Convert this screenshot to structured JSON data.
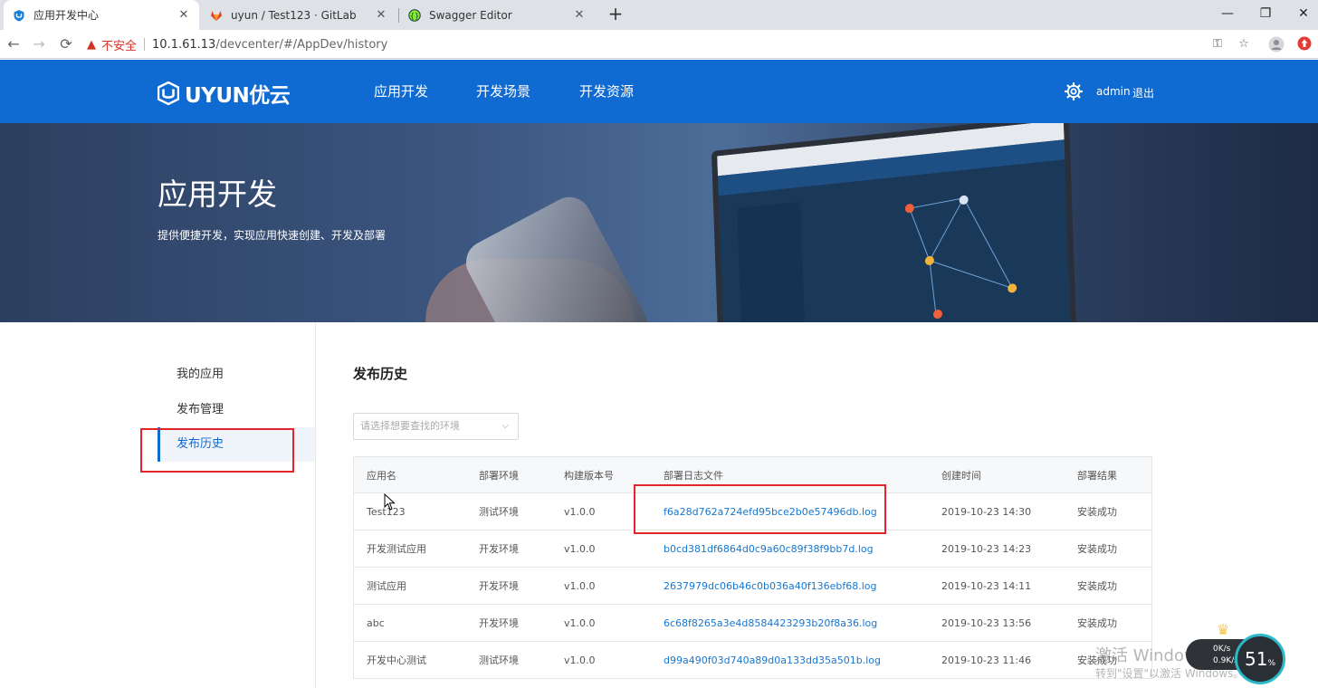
{
  "browser": {
    "tabs": [
      {
        "title": "应用开发中心",
        "active": true,
        "favicon": "uyun-shield-icon"
      },
      {
        "title": "uyun / Test123 · GitLab",
        "active": false,
        "favicon": "gitlab-fox-icon"
      },
      {
        "title": "Swagger Editor",
        "active": false,
        "favicon": "swagger-icon"
      }
    ],
    "new_tab": "+",
    "security_warning": "不安全",
    "url_host": "10.1.61.13",
    "url_path": "/devcenter/#/AppDev/history"
  },
  "header": {
    "logo_text": "UYUN优云",
    "nav": [
      "应用开发",
      "开发场景",
      "开发资源"
    ],
    "user": "admin",
    "logout": "退出",
    "brand_color": "#0f6ad1"
  },
  "banner": {
    "title": "应用开发",
    "subtitle": "提供便捷开发，实现应用快速创建、开发及部署"
  },
  "sidebar": {
    "items": [
      {
        "label": "我的应用",
        "active": false
      },
      {
        "label": "发布管理",
        "active": false
      },
      {
        "label": "发布历史",
        "active": true
      }
    ]
  },
  "main": {
    "title": "发布历史",
    "env_placeholder": "请选择想要查找的环境",
    "columns": [
      "应用名",
      "部署环境",
      "构建版本号",
      "部署日志文件",
      "创建时间",
      "部署结果"
    ],
    "rows": [
      {
        "app": "Test123",
        "env": "测试环境",
        "version": "v1.0.0",
        "log": "f6a28d762a724efd95bce2b0e57496db.log",
        "created": "2019-10-23 14:30",
        "result": "安装成功"
      },
      {
        "app": "开发测试应用",
        "env": "开发环境",
        "version": "v1.0.0",
        "log": "b0cd381df6864d0c9a60c89f38f9bb7d.log",
        "created": "2019-10-23 14:23",
        "result": "安装成功"
      },
      {
        "app": "测试应用",
        "env": "开发环境",
        "version": "v1.0.0",
        "log": "2637979dc06b46c0b036a40f136ebf68.log",
        "created": "2019-10-23 14:11",
        "result": "安装成功"
      },
      {
        "app": "abc",
        "env": "开发环境",
        "version": "v1.0.0",
        "log": "6c68f8265a3e4d8584423293b20f8a36.log",
        "created": "2019-10-23 13:56",
        "result": "安装成功"
      },
      {
        "app": "开发中心测试",
        "env": "测试环境",
        "version": "v1.0.0",
        "log": "d99a490f03d740a89d0a133dd35a501b.log",
        "created": "2019-10-23 11:46",
        "result": "安装成功"
      }
    ]
  },
  "overlay": {
    "watermark_line1": "激活 Windows",
    "watermark_line2": "转到\"设置\"以激活 Windows。",
    "net_up": "0K/s",
    "net_down": "0.9K/s",
    "cpu_percent": "51",
    "cpu_unit": "%"
  }
}
